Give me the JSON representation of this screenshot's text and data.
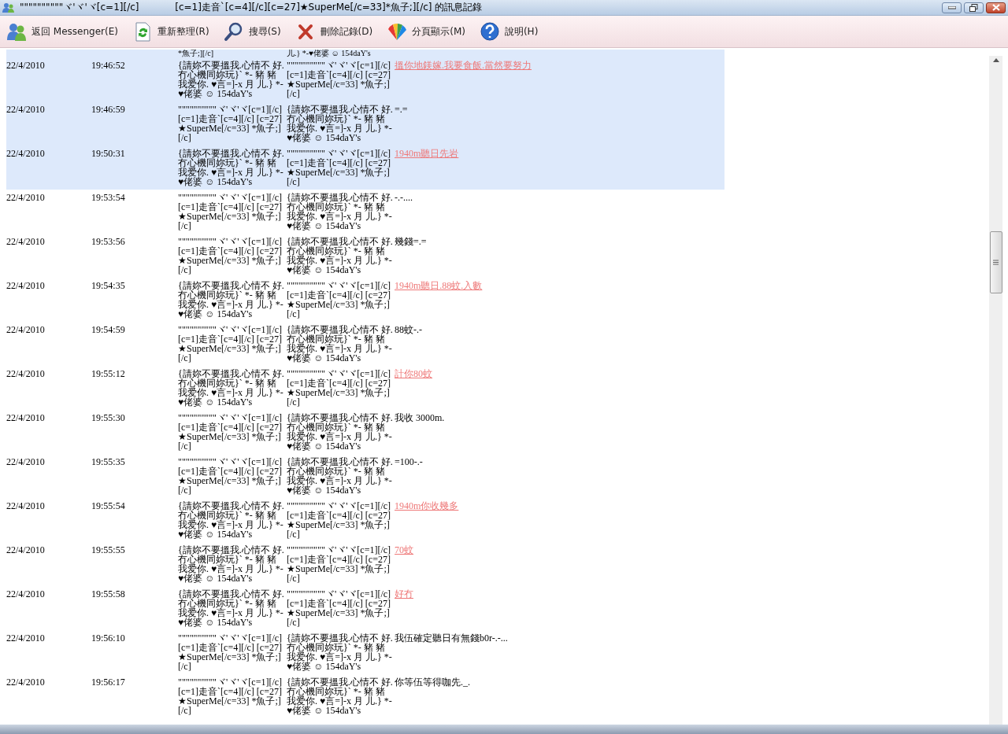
{
  "window": {
    "title": "\"\"\"\"\"\"\"\"\"\"ヾ'ヾ'ヾ[c=1][/c]            [c=1]走音`[c=4][/c][c=27]★SuperMe[/c=33]*魚子;][/c] 的訊息記錄"
  },
  "toolbar": [
    {
      "kind": "back",
      "label": "返回 Messenger(E)"
    },
    {
      "kind": "refresh",
      "label": "重新整理(R)"
    },
    {
      "kind": "search",
      "label": "搜尋(S)"
    },
    {
      "kind": "delete",
      "label": "刪除記錄(D)"
    },
    {
      "kind": "paging",
      "label": "分頁顯示(M)"
    },
    {
      "kind": "help",
      "label": "說明(H)"
    }
  ],
  "partial_row": {
    "from": "*魚子;][/c]",
    "to": "儿.} *-♥佬婆 ☺ 154daY's"
  },
  "rows": [
    {
      "date": "22/4/2010",
      "time": "19:46:52",
      "from": "{請妳不要搵我.心情不\n好.冇心機同妳玩}` *- 豬\n豬我爱你. ♥言=]-x 月\n儿.} *-♥佬婆 ☺ 154daY's",
      "to": "\"\"\"\"\"\"\"\"\"\"ヾ'ヾ'ヾ[c=1][/c]\n[c=1]走音`[c=4][/c]\n[c=27]★SuperMe[/c=33]\n*魚子;][/c]",
      "message": "搵你地鎂嫁.我要食飯.當然要努力",
      "kind": "link",
      "selected": true
    },
    {
      "date": "22/4/2010",
      "time": "19:46:59",
      "from": "\"\"\"\"\"\"\"\"\"\"ヾ'ヾ'ヾ[c=1][/c]\n[c=1]走音`[c=4][/c]\n[c=27]★SuperMe[/c=33]\n*魚子;][/c]",
      "to": "{請妳不要搵我.心情不\n好.冇心機同妳玩}` *- 豬\n豬我爱你. ♥言=]-x 月\n儿.} *-♥佬婆 ☺ 154daY's",
      "message": "=.=",
      "kind": "plain",
      "selected": true
    },
    {
      "date": "22/4/2010",
      "time": "19:50:31",
      "from": "{請妳不要搵我.心情不\n好.冇心機同妳玩}` *- 豬\n豬我爱你. ♥言=]-x 月\n儿.} *-♥佬婆 ☺ 154daY's",
      "to": "\"\"\"\"\"\"\"\"\"\"ヾ'ヾ'ヾ[c=1][/c]\n[c=1]走音`[c=4][/c]\n[c=27]★SuperMe[/c=33]\n*魚子;][/c]",
      "message": "1940m聽日先岩",
      "kind": "link",
      "selected": true
    },
    {
      "date": "22/4/2010",
      "time": "19:53:54",
      "from": "\"\"\"\"\"\"\"\"\"\"ヾ'ヾ'ヾ[c=1][/c]\n[c=1]走音`[c=4][/c]\n[c=27]★SuperMe[/c=33]\n*魚子;][/c]",
      "to": "{請妳不要搵我.心情不\n好.冇心機同妳玩}` *- 豬\n豬我爱你. ♥言=]-x 月\n儿.} *-♥佬婆 ☺ 154daY's",
      "message": "-.-....",
      "kind": "plain",
      "selected": false
    },
    {
      "date": "22/4/2010",
      "time": "19:53:56",
      "from": "\"\"\"\"\"\"\"\"\"\"ヾ'ヾ'ヾ[c=1][/c]\n[c=1]走音`[c=4][/c]\n[c=27]★SuperMe[/c=33]\n*魚子;][/c]",
      "to": "{請妳不要搵我.心情不\n好.冇心機同妳玩}` *- 豬\n豬我爱你. ♥言=]-x 月\n儿.} *-♥佬婆 ☺ 154daY's",
      "message": "幾錢=.=",
      "kind": "plain",
      "selected": false
    },
    {
      "date": "22/4/2010",
      "time": "19:54:35",
      "from": "{請妳不要搵我.心情不\n好.冇心機同妳玩}` *- 豬\n豬我爱你. ♥言=]-x 月\n儿.} *-♥佬婆 ☺ 154daY's",
      "to": "\"\"\"\"\"\"\"\"\"\"ヾ'ヾ'ヾ[c=1][/c]\n[c=1]走音`[c=4][/c]\n[c=27]★SuperMe[/c=33]\n*魚子;][/c]",
      "message": "1940m聽日.88蚊.入數",
      "kind": "link",
      "selected": false
    },
    {
      "date": "22/4/2010",
      "time": "19:54:59",
      "from": "\"\"\"\"\"\"\"\"\"\"ヾ'ヾ'ヾ[c=1][/c]\n[c=1]走音`[c=4][/c]\n[c=27]★SuperMe[/c=33]\n*魚子;][/c]",
      "to": "{請妳不要搵我.心情不\n好.冇心機同妳玩}` *- 豬\n豬我爱你. ♥言=]-x 月\n儿.} *-♥佬婆 ☺ 154daY's",
      "message": "88蚊-.-",
      "kind": "plain",
      "selected": false
    },
    {
      "date": "22/4/2010",
      "time": "19:55:12",
      "from": "{請妳不要搵我.心情不\n好.冇心機同妳玩}` *- 豬\n豬我爱你. ♥言=]-x 月\n儿.} *-♥佬婆 ☺ 154daY's",
      "to": "\"\"\"\"\"\"\"\"\"\"ヾ'ヾ'ヾ[c=1][/c]\n[c=1]走音`[c=4][/c]\n[c=27]★SuperMe[/c=33]\n*魚子;][/c]",
      "message": "計你80蚊",
      "kind": "link",
      "selected": false
    },
    {
      "date": "22/4/2010",
      "time": "19:55:30",
      "from": "\"\"\"\"\"\"\"\"\"\"ヾ'ヾ'ヾ[c=1][/c]\n[c=1]走音`[c=4][/c]\n[c=27]★SuperMe[/c=33]\n*魚子;][/c]",
      "to": "{請妳不要搵我.心情不\n好.冇心機同妳玩}` *- 豬\n豬我爱你. ♥言=]-x 月\n儿.} *-♥佬婆 ☺ 154daY's",
      "message": "我收 3000m.",
      "kind": "plain",
      "selected": false
    },
    {
      "date": "22/4/2010",
      "time": "19:55:35",
      "from": "\"\"\"\"\"\"\"\"\"\"ヾ'ヾ'ヾ[c=1][/c]\n[c=1]走音`[c=4][/c]\n[c=27]★SuperMe[/c=33]\n*魚子;][/c]",
      "to": "{請妳不要搵我.心情不\n好.冇心機同妳玩}` *- 豬\n豬我爱你. ♥言=]-x 月\n儿.} *-♥佬婆 ☺ 154daY's",
      "message": "=100-.-",
      "kind": "plain",
      "selected": false
    },
    {
      "date": "22/4/2010",
      "time": "19:55:54",
      "from": "{請妳不要搵我.心情不\n好.冇心機同妳玩}` *- 豬\n豬我爱你. ♥言=]-x 月\n儿.} *-♥佬婆 ☺ 154daY's",
      "to": "\"\"\"\"\"\"\"\"\"\"ヾ'ヾ'ヾ[c=1][/c]\n[c=1]走音`[c=4][/c]\n[c=27]★SuperMe[/c=33]\n*魚子;][/c]",
      "message": "1940m你收幾多",
      "kind": "link",
      "selected": false
    },
    {
      "date": "22/4/2010",
      "time": "19:55:55",
      "from": "{請妳不要搵我.心情不\n好.冇心機同妳玩}` *- 豬\n豬我爱你. ♥言=]-x 月\n儿.} *-♥佬婆 ☺ 154daY's",
      "to": "\"\"\"\"\"\"\"\"\"\"ヾ'ヾ'ヾ[c=1][/c]\n[c=1]走音`[c=4][/c]\n[c=27]★SuperMe[/c=33]\n*魚子;][/c]",
      "message": "70蚊",
      "kind": "link",
      "selected": false
    },
    {
      "date": "22/4/2010",
      "time": "19:55:58",
      "from": "{請妳不要搵我.心情不\n好.冇心機同妳玩}` *- 豬\n豬我爱你. ♥言=]-x 月\n儿.} *-♥佬婆 ☺ 154daY's",
      "to": "\"\"\"\"\"\"\"\"\"\"ヾ'ヾ'ヾ[c=1][/c]\n[c=1]走音`[c=4][/c]\n[c=27]★SuperMe[/c=33]\n*魚子;][/c]",
      "message": "好冇",
      "kind": "link",
      "selected": false
    },
    {
      "date": "22/4/2010",
      "time": "19:56:10",
      "from": "\"\"\"\"\"\"\"\"\"\"ヾ'ヾ'ヾ[c=1][/c]\n[c=1]走音`[c=4][/c]\n[c=27]★SuperMe[/c=33]\n*魚子;][/c]",
      "to": "{請妳不要搵我.心情不\n好.冇心機同妳玩}` *- 豬\n豬我爱你. ♥言=]-x 月\n儿.} *-♥佬婆 ☺ 154daY's",
      "message": "我伍確定聽日有無錢b0r-.-...",
      "kind": "plain",
      "selected": false
    },
    {
      "date": "22/4/2010",
      "time": "19:56:17",
      "from": "\"\"\"\"\"\"\"\"\"\"ヾ'ヾ'ヾ[c=1][/c]\n[c=1]走音`[c=4][/c]\n[c=27]★SuperMe[/c=33]\n*魚子;][/c]",
      "to": "{請妳不要搵我.心情不\n好.冇心機同妳玩}` *- 豬\n豬我爱你. ♥言=]-x 月\n儿.} *-♥佬婆 ☺ 154daY's",
      "message": "你等伍等得咖先._.",
      "kind": "plain",
      "selected": false
    }
  ]
}
